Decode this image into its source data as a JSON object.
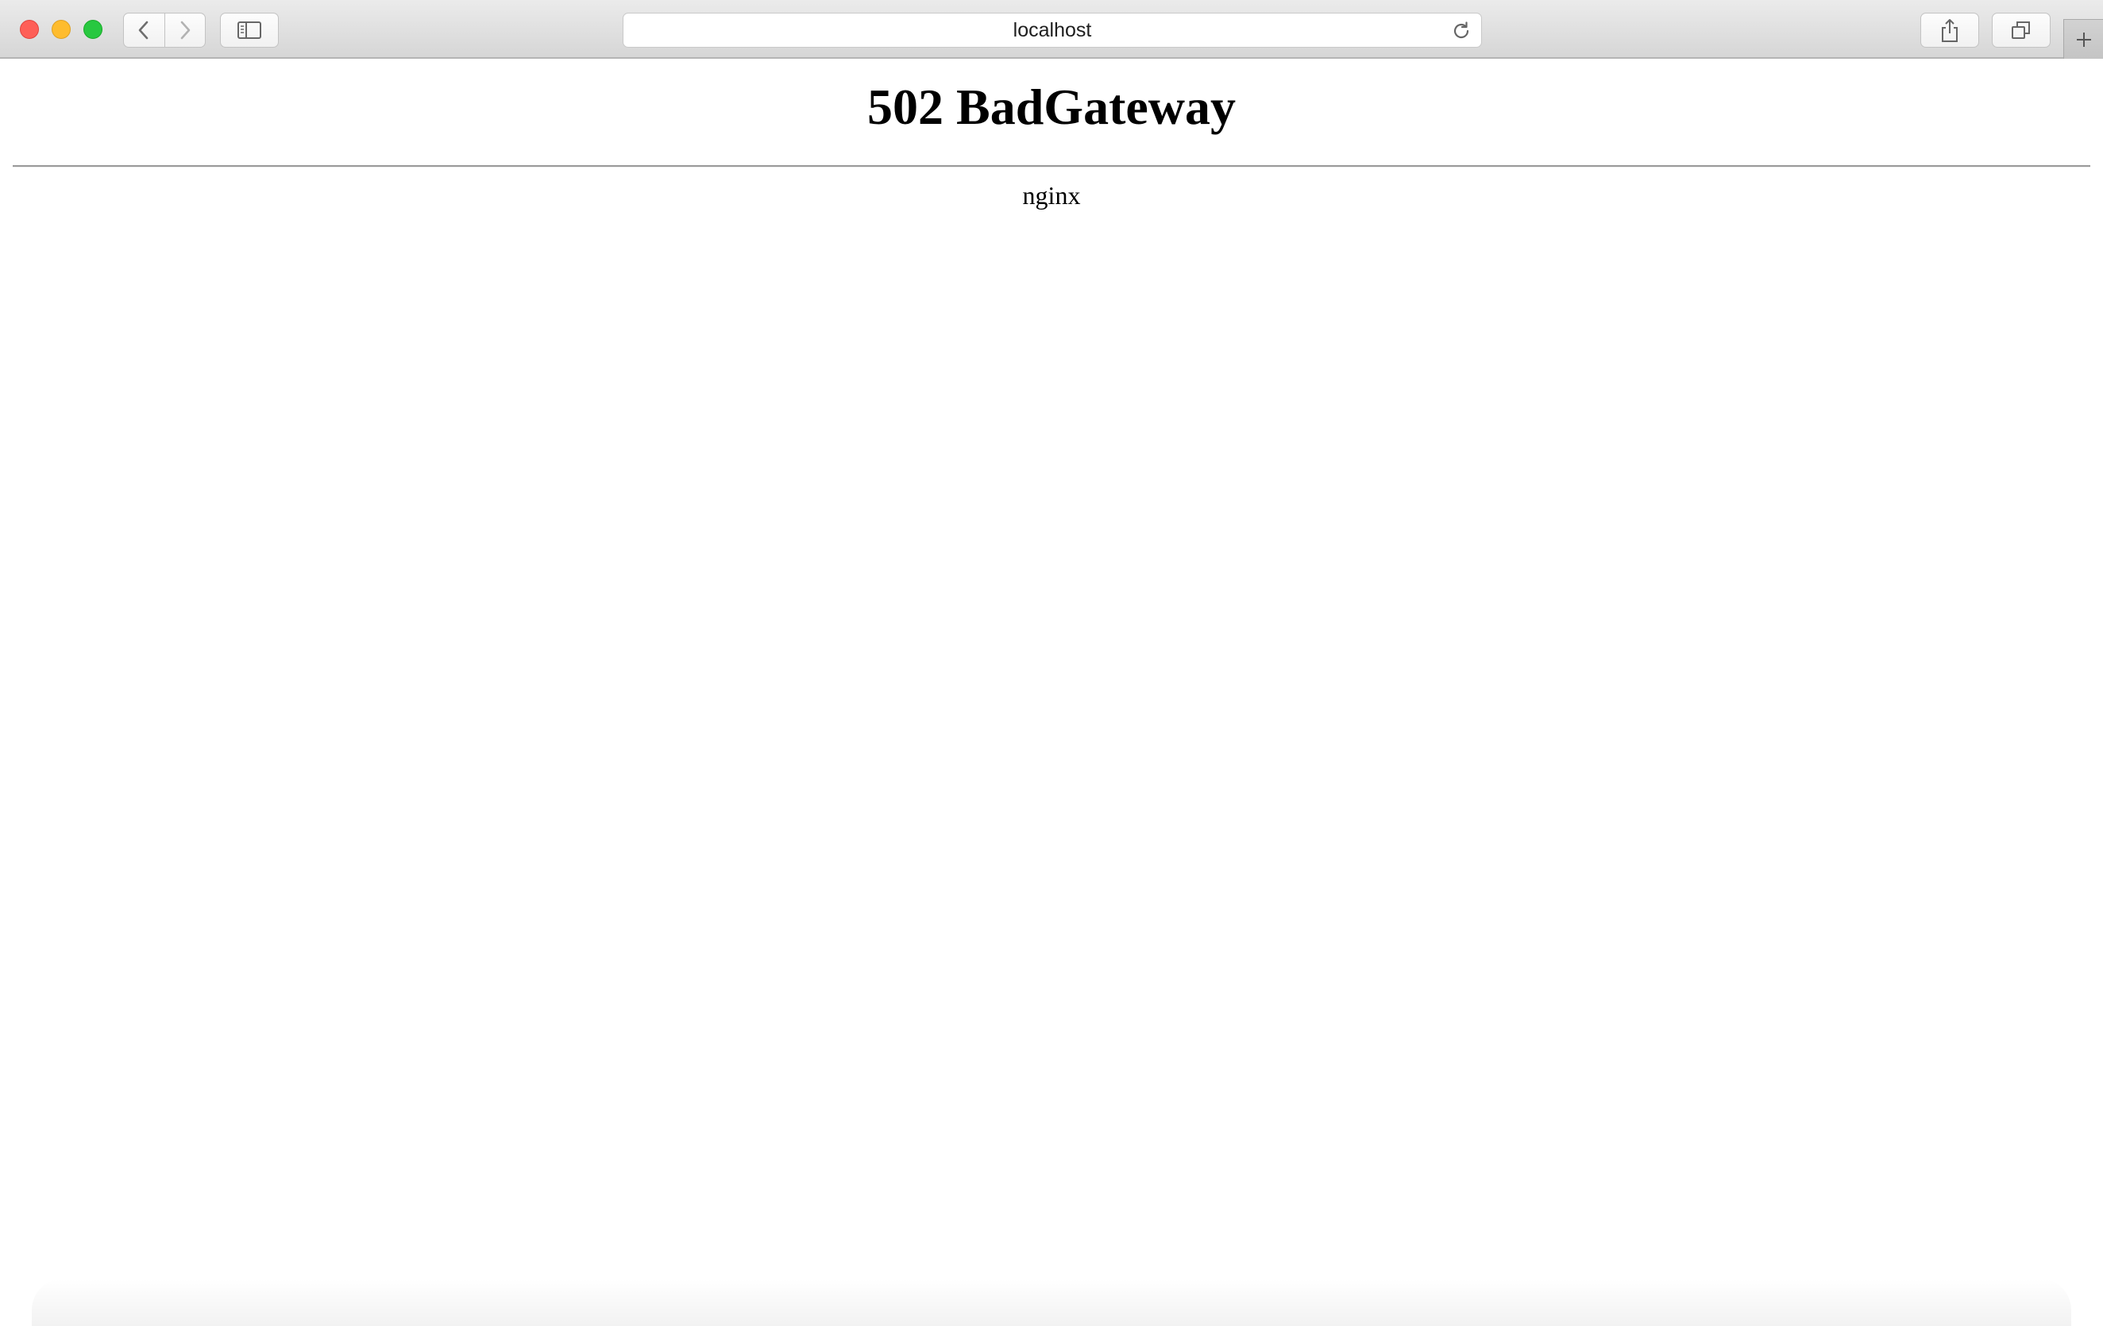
{
  "browser": {
    "address_bar": {
      "url": "localhost"
    },
    "icons": {
      "back": "chevron-left-icon",
      "forward": "chevron-right-icon",
      "sidebar": "sidebar-icon",
      "reload": "reload-icon",
      "share": "share-icon",
      "tabs": "tabs-overview-icon",
      "new_tab": "plus-icon"
    },
    "traffic_lights": {
      "close_color": "#fe5f57",
      "minimize_color": "#febc2e",
      "maximize_color": "#28c840"
    }
  },
  "page": {
    "title": "502 BadGateway",
    "server": "nginx"
  }
}
